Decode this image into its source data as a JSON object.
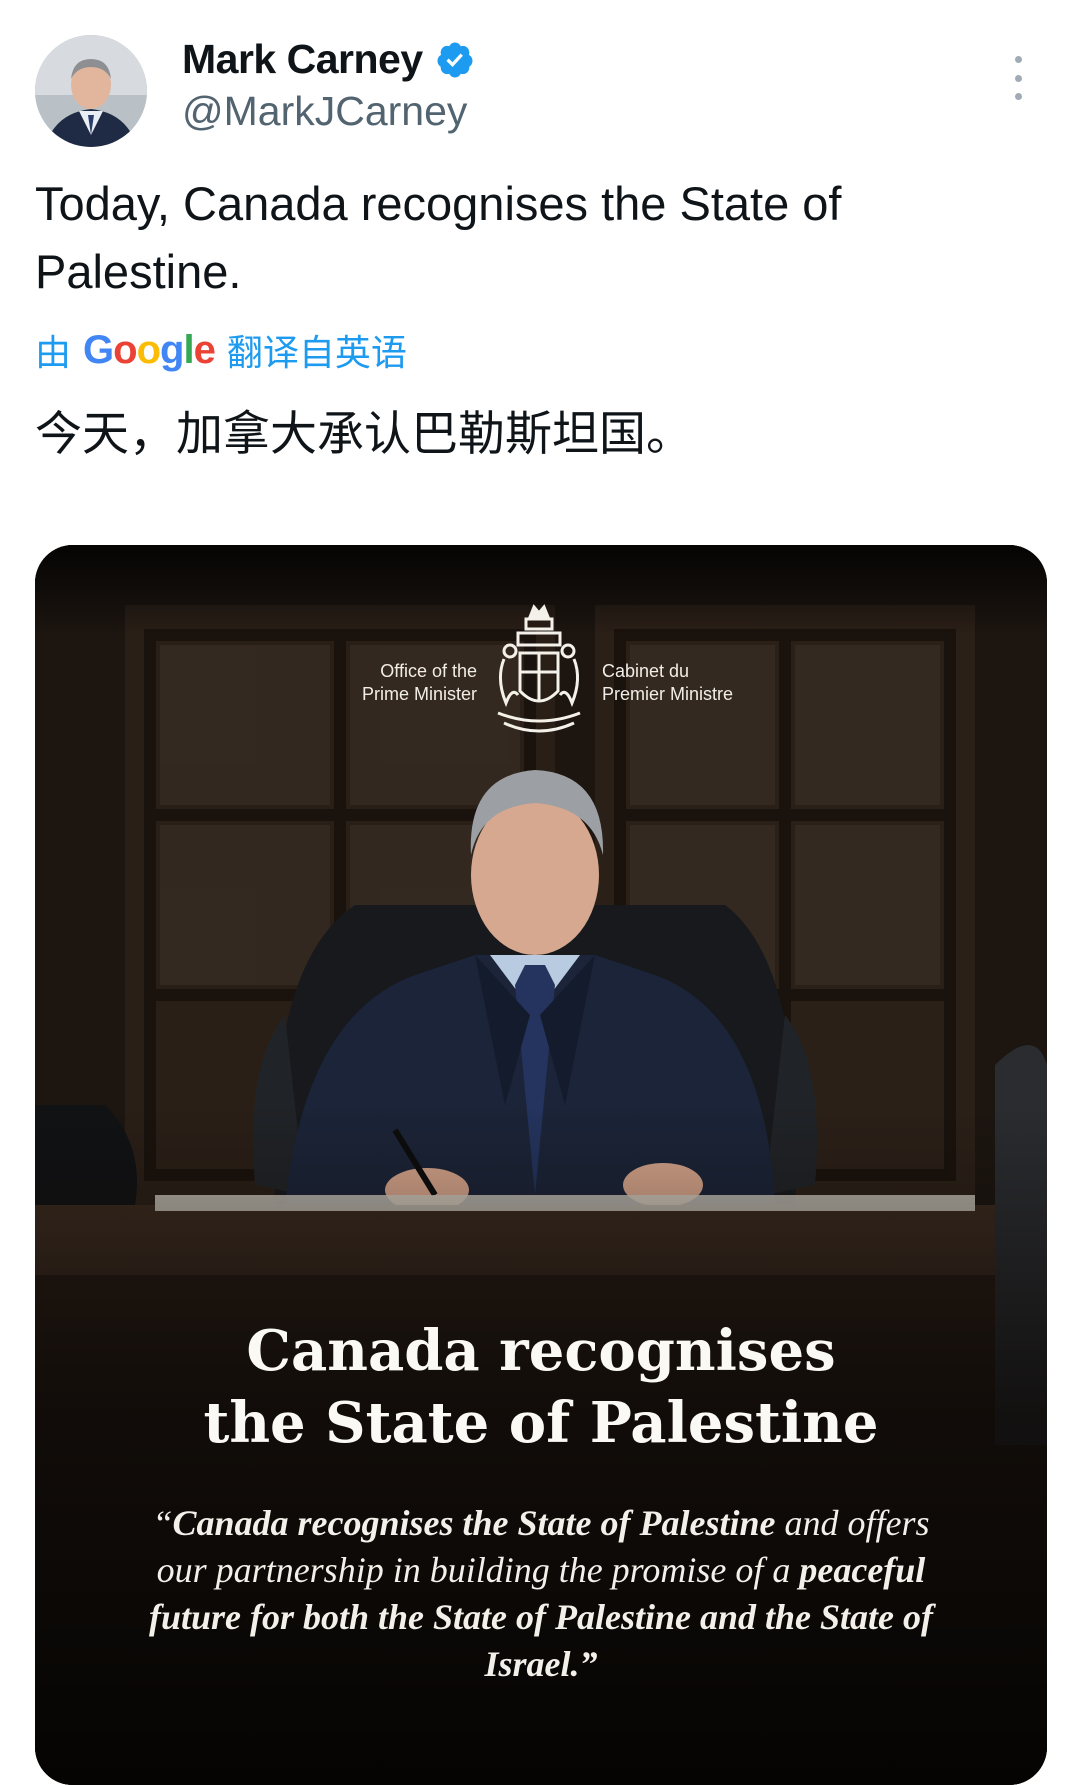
{
  "author": {
    "name": "Mark Carney",
    "handle": "@MarkJCarney",
    "verified": true
  },
  "tweet": {
    "text": "Today, Canada recognises the State of Palestine.",
    "translate": {
      "prefix": "由",
      "brand": "Google",
      "suffix": "翻译自英语"
    },
    "translated_text": "今天，加拿大承认巴勒斯坦国。"
  },
  "media": {
    "office_en": [
      "Office of the",
      "Prime Minister"
    ],
    "office_fr": [
      "Cabinet du",
      "Premier Ministre"
    ],
    "headline": [
      "Canada recognises",
      "the State of Palestine"
    ],
    "quote": {
      "open_mark": "“",
      "bold1": "Canada recognises the State of Palestine",
      "plain1": " and offers our partnership in building the promise of a ",
      "bold2": "peaceful future for both the State of Palestine and the State of Israel.",
      "close_mark": "”"
    }
  },
  "colors": {
    "accent": "#1d9bf0",
    "text": "#0f1419",
    "muted": "#536471",
    "card_bg": "#0b0806"
  },
  "icons": {
    "verified": "verified-badge-icon",
    "more": "more-vertical-icon",
    "coat_of_arms": "coat-of-arms-icon"
  }
}
